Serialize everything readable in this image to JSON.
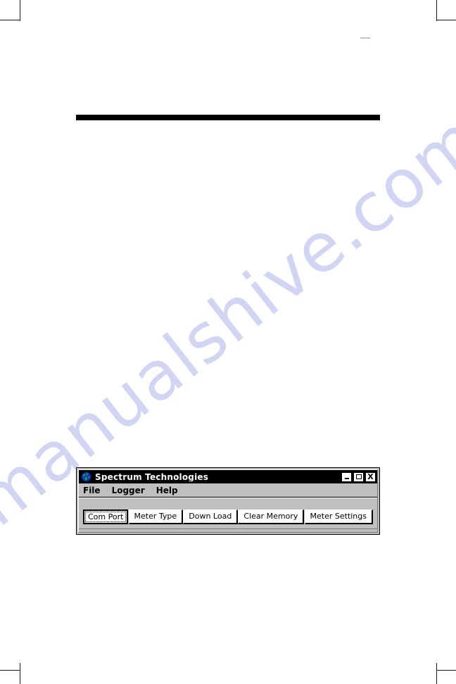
{
  "page": {
    "background_color": "#ffffff",
    "rule_color": "#000000",
    "crop_marks": [
      "top-left",
      "top-right",
      "bottom-left",
      "bottom-right"
    ]
  },
  "watermark": {
    "text": "manualshive.com",
    "color": "#c9cdf2"
  },
  "window": {
    "title": "Spectrum Technologies",
    "icon": "globe-icon",
    "titlebar_color": "#000000",
    "titlebar_text_color": "#ffffff",
    "face_color": "#c0c0c0",
    "controls": [
      {
        "name": "minimize",
        "glyph": "_"
      },
      {
        "name": "maximize",
        "glyph": "□"
      },
      {
        "name": "close",
        "glyph": "X"
      }
    ],
    "menu": [
      {
        "label": "File"
      },
      {
        "label": "Logger"
      },
      {
        "label": "Help"
      }
    ],
    "toolbar": {
      "buttons": [
        {
          "label": "Com Port",
          "focused": true
        },
        {
          "label": "Meter Type",
          "focused": false
        },
        {
          "label": "Down Load",
          "focused": false
        },
        {
          "label": "Clear Memory",
          "focused": false
        },
        {
          "label": "Meter Settings",
          "focused": false
        }
      ]
    }
  }
}
